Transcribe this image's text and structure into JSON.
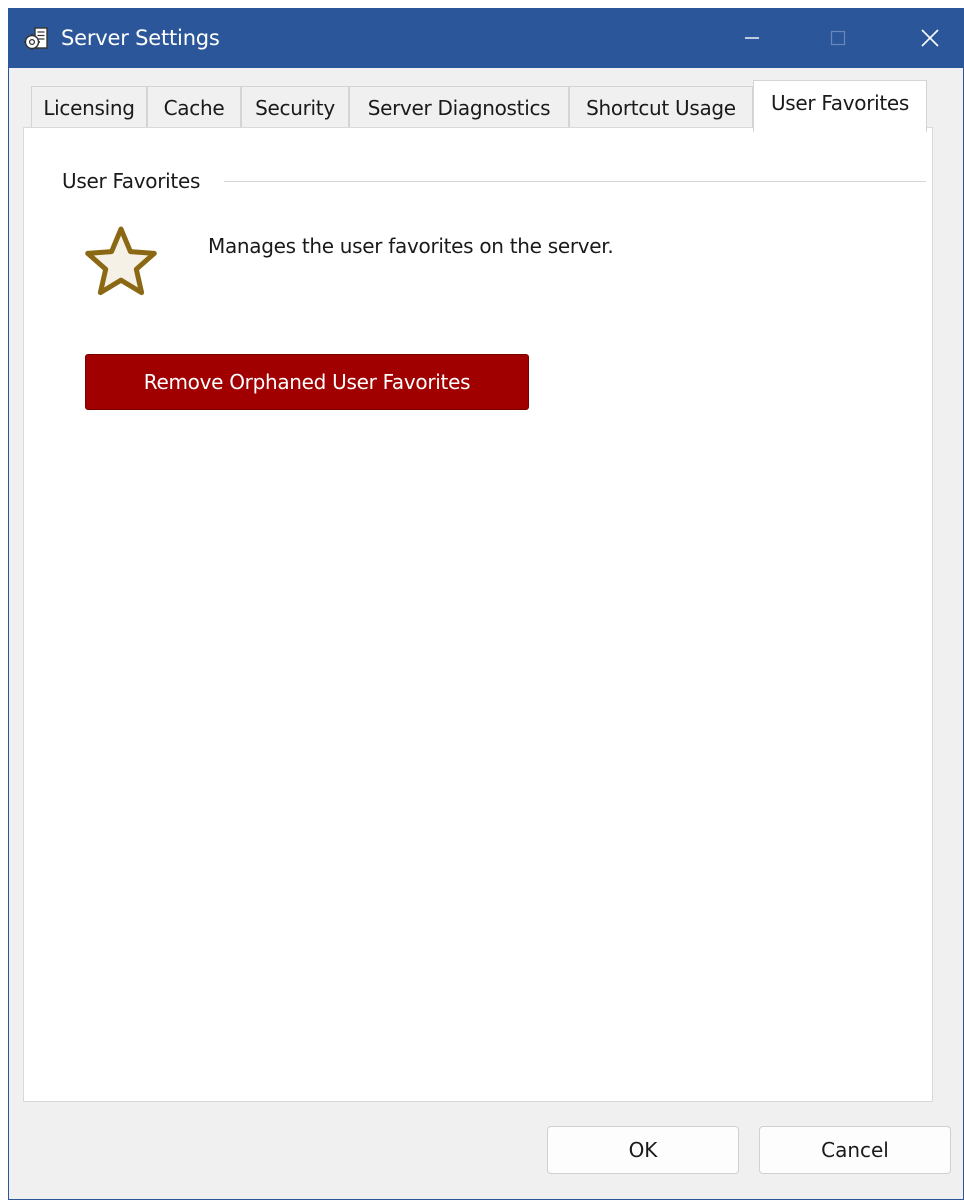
{
  "window": {
    "title": "Server Settings",
    "app_icon": "server-settings-icon",
    "controls": [
      "minimize-icon",
      "maximize-icon",
      "close-icon"
    ]
  },
  "tabs": [
    {
      "label": "Licensing",
      "active": false
    },
    {
      "label": "Cache",
      "active": false
    },
    {
      "label": "Security",
      "active": false
    },
    {
      "label": "Server Diagnostics",
      "active": false
    },
    {
      "label": "Shortcut Usage",
      "active": false
    },
    {
      "label": "User Favorites",
      "active": true
    }
  ],
  "panel": {
    "group_title": "User Favorites",
    "icon": "star-icon",
    "description": "Manages the user favorites on the server.",
    "action_button": "Remove Orphaned User Favorites"
  },
  "footer": {
    "ok_label": "OK",
    "cancel_label": "Cancel"
  },
  "colors": {
    "titlebar": "#2b579a",
    "action_button": "#a00000",
    "star_outline": "#8b6914",
    "star_fill": "#f6f1e7"
  }
}
